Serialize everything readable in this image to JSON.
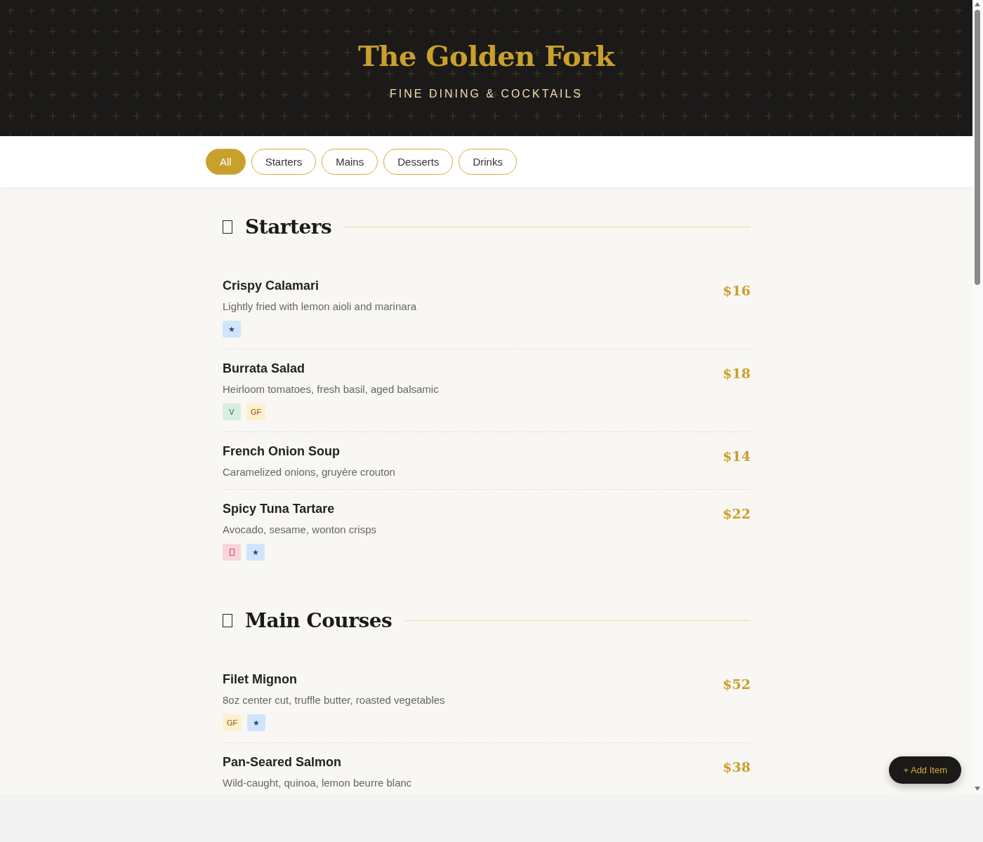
{
  "header": {
    "title": "The Golden Fork",
    "tagline": "FINE DINING & COCKTAILS"
  },
  "filters": [
    {
      "label": "All",
      "selected": true
    },
    {
      "label": "Starters",
      "selected": false
    },
    {
      "label": "Mains",
      "selected": false
    },
    {
      "label": "Desserts",
      "selected": false
    },
    {
      "label": "Drinks",
      "selected": false
    }
  ],
  "sections": [
    {
      "title": "Starters",
      "items": [
        {
          "name": "Crispy Calamari",
          "description": "Lightly fried with lemon aioli and marinara",
          "price": "$16",
          "badges": [
            {
              "kind": "chef",
              "text": "★"
            }
          ]
        },
        {
          "name": "Burrata Salad",
          "description": "Heirloom tomatoes, fresh basil, aged balsamic",
          "price": "$18",
          "badges": [
            {
              "kind": "veg",
              "text": "V"
            },
            {
              "kind": "gf",
              "text": "GF"
            }
          ]
        },
        {
          "name": "French Onion Soup",
          "description": "Caramelized onions, gruyère crouton",
          "price": "$14"
        },
        {
          "name": "Spicy Tuna Tartare",
          "description": "Avocado, sesame, wonton crisps",
          "price": "$22",
          "badges": [
            {
              "kind": "spicy"
            },
            {
              "kind": "chef",
              "text": "★"
            }
          ]
        }
      ]
    },
    {
      "title": "Main Courses",
      "items": [
        {
          "name": "Filet Mignon",
          "description": "8oz center cut, truffle butter, roasted vegetables",
          "price": "$52",
          "badges": [
            {
              "kind": "gf",
              "text": "GF"
            },
            {
              "kind": "chef",
              "text": "★"
            }
          ]
        },
        {
          "name": "Pan-Seared Salmon",
          "description": "Wild-caught, quinoa, lemon beurre blanc",
          "price": "$38"
        }
      ]
    }
  ],
  "add_button": {
    "label": "+ Add Item"
  }
}
